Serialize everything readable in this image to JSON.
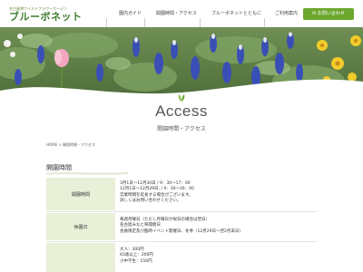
{
  "header": {
    "logo_subtitle": "名古屋港ワイルドフラワーガーデン",
    "logo_title": "ブルーボネット",
    "nav": [
      {
        "label": "園内ガイド"
      },
      {
        "label": "開園時間・アクセス"
      },
      {
        "label": "ブルーボネットとともに"
      },
      {
        "label": "ご利用案内"
      }
    ],
    "contact_label": "お問い合わせ"
  },
  "page": {
    "title": "Access",
    "subtitle": "開園時間・アクセス",
    "breadcrumb": "HOME > 開園時間・アクセス",
    "section_heading": "開園時間"
  },
  "table": {
    "rows": [
      {
        "label": "開園時間",
        "lines": [
          "3月1日～11月30日 / 9：30～17：00",
          "12月1日～12月29日, / 9：30～16：00",
          "営業時間を延長する場合がございます。",
          "詳しくはお問い合わせください。"
        ]
      },
      {
        "label": "休園日",
        "lines": [
          "毎週月曜日（ただし月曜日が祝日の場合は翌日）",
          "名古屋みなと祭開催日",
          "会員限定及び臨時イベント開催日、冬季（12月29日～翌2月末日）"
        ]
      },
      {
        "label": "",
        "lines": [
          "大人：300円",
          "65歳以上：200円",
          "小中学生：150円"
        ]
      }
    ]
  },
  "colors": {
    "brand_green": "#3e7b2f",
    "accent_green": "#6ca72e",
    "table_head_bg": "#e9f0d8"
  }
}
